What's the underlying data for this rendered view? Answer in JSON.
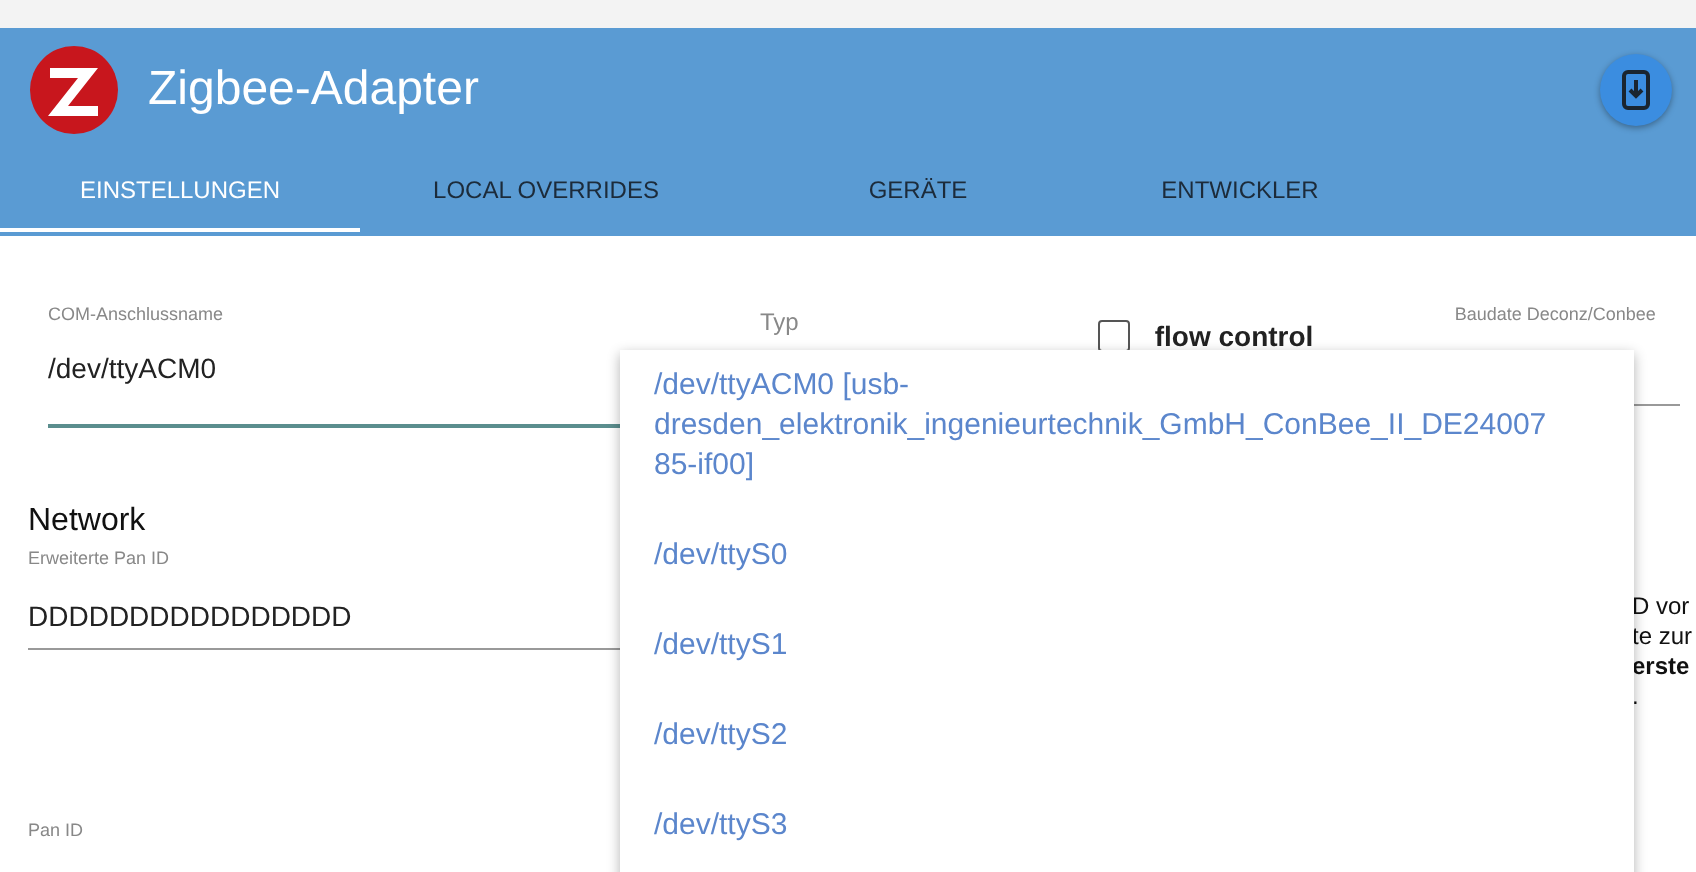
{
  "header": {
    "title": "Zigbee-Adapter"
  },
  "tabs": [
    {
      "label": "EINSTELLUNGEN",
      "selected": true
    },
    {
      "label": "LOCAL OVERRIDES",
      "selected": false
    },
    {
      "label": "GERÄTE",
      "selected": false
    },
    {
      "label": "ENTWICKLER",
      "selected": false
    }
  ],
  "com_port": {
    "label": "COM-Anschlussname",
    "value": "/dev/ttyACM0"
  },
  "type": {
    "label": "Typ"
  },
  "flow_control": {
    "label": "flow control",
    "checked": false
  },
  "baudrate": {
    "label": "Baudate Deconz/Conbee"
  },
  "network": {
    "heading": "Network",
    "extended_pan_id": {
      "label": "Erweiterte Pan ID",
      "value": "DDDDDDDDDDDDDDDD"
    },
    "pan_id": {
      "label": "Pan ID"
    }
  },
  "side_note": [
    {
      "text": "D vor",
      "bold": false
    },
    {
      "text": "te zur",
      "bold": false
    },
    {
      "text": "erste",
      "bold": true
    },
    {
      "text": ".",
      "bold": false
    }
  ],
  "dropdown": {
    "options": [
      {
        "label": "/dev/ttyACM0 [usb-dresden_elektronik_ingenieurtechnik_GmbH_ConBee_II_DE2400785-if00]"
      },
      {
        "label": "/dev/ttyS0"
      },
      {
        "label": "/dev/ttyS1"
      },
      {
        "label": "/dev/ttyS2"
      },
      {
        "label": "/dev/ttyS3"
      }
    ]
  }
}
